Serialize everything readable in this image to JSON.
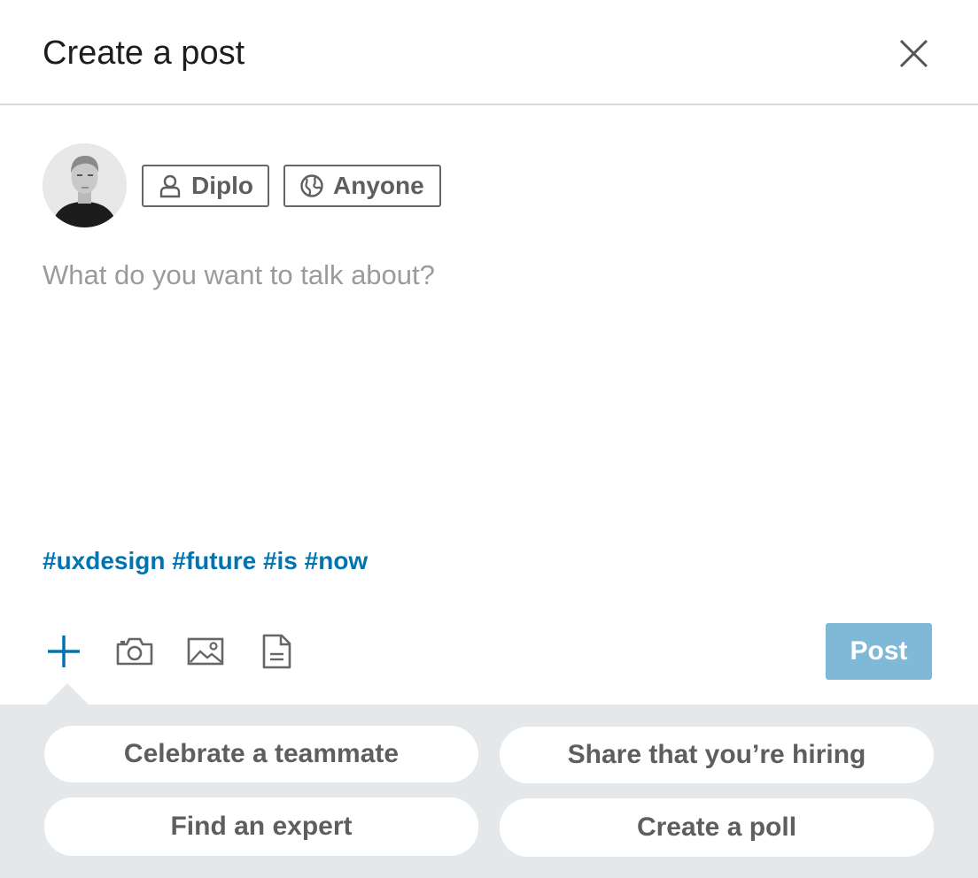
{
  "header": {
    "title": "Create a post",
    "close_icon": "close-icon"
  },
  "author": {
    "avatar_icon": "avatar",
    "name": "Diplo",
    "name_icon": "person-icon",
    "visibility": "Anyone",
    "visibility_icon": "globe-icon"
  },
  "editor": {
    "placeholder": "What do you want to talk about?",
    "hashtags": "#uxdesign #future #is #now"
  },
  "toolbar": {
    "add_icon": "plus-icon",
    "camera_icon": "camera-icon",
    "image_icon": "image-icon",
    "document_icon": "document-icon",
    "post_label": "Post"
  },
  "suggestions": [
    {
      "label": "Celebrate a teammate"
    },
    {
      "label": "Share that you’re hiring"
    },
    {
      "label": "Find an expert"
    },
    {
      "label": "Create a poll"
    }
  ],
  "colors": {
    "accent": "#0073b1",
    "post_button_disabled": "#80b9d8",
    "panel_background": "#e5e8ea",
    "placeholder_text": "#9b9b9b"
  }
}
